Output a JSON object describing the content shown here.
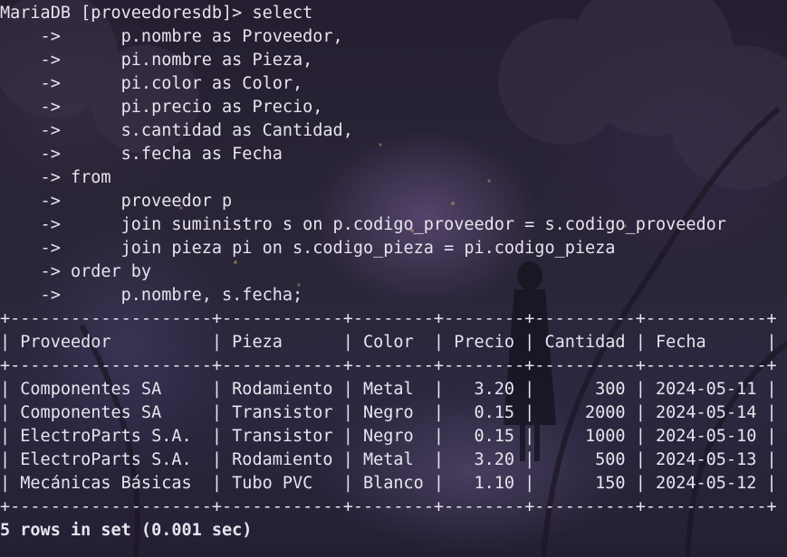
{
  "terminal": {
    "query_lines": [
      "MariaDB [proveedoresdb]> select",
      "    ->      p.nombre as Proveedor,",
      "    ->      pi.nombre as Pieza,",
      "    ->      pi.color as Color,",
      "    ->      pi.precio as Precio,",
      "    ->      s.cantidad as Cantidad,",
      "    ->      s.fecha as Fecha",
      "    -> from",
      "    ->      proveedor p",
      "    ->      join suministro s on p.codigo_proveedor = s.codigo_proveedor",
      "    ->      join pieza pi on s.codigo_pieza = pi.codigo_pieza",
      "    -> order by",
      "    ->      p.nombre, s.fecha;"
    ],
    "table": {
      "border": "+--------------------+------------+--------+--------+----------+------------+",
      "header": "| Proveedor          | Pieza      | Color  | Precio | Cantidad | Fecha      |",
      "rows": [
        "| Componentes SA     | Rodamiento | Metal  |   3.20 |      300 | 2024-05-11 |",
        "| Componentes SA     | Transistor | Negro  |   0.15 |     2000 | 2024-05-14 |",
        "| ElectroParts S.A.  | Transistor | Negro  |   0.15 |     1000 | 2024-05-10 |",
        "| ElectroParts S.A.  | Rodamiento | Metal  |   3.20 |      500 | 2024-05-13 |",
        "| Mecánicas Básicas  | Tubo PVC   | Blanco |   1.10 |      150 | 2024-05-12 |"
      ]
    },
    "summary": "5 rows in set (0.001 sec)"
  }
}
